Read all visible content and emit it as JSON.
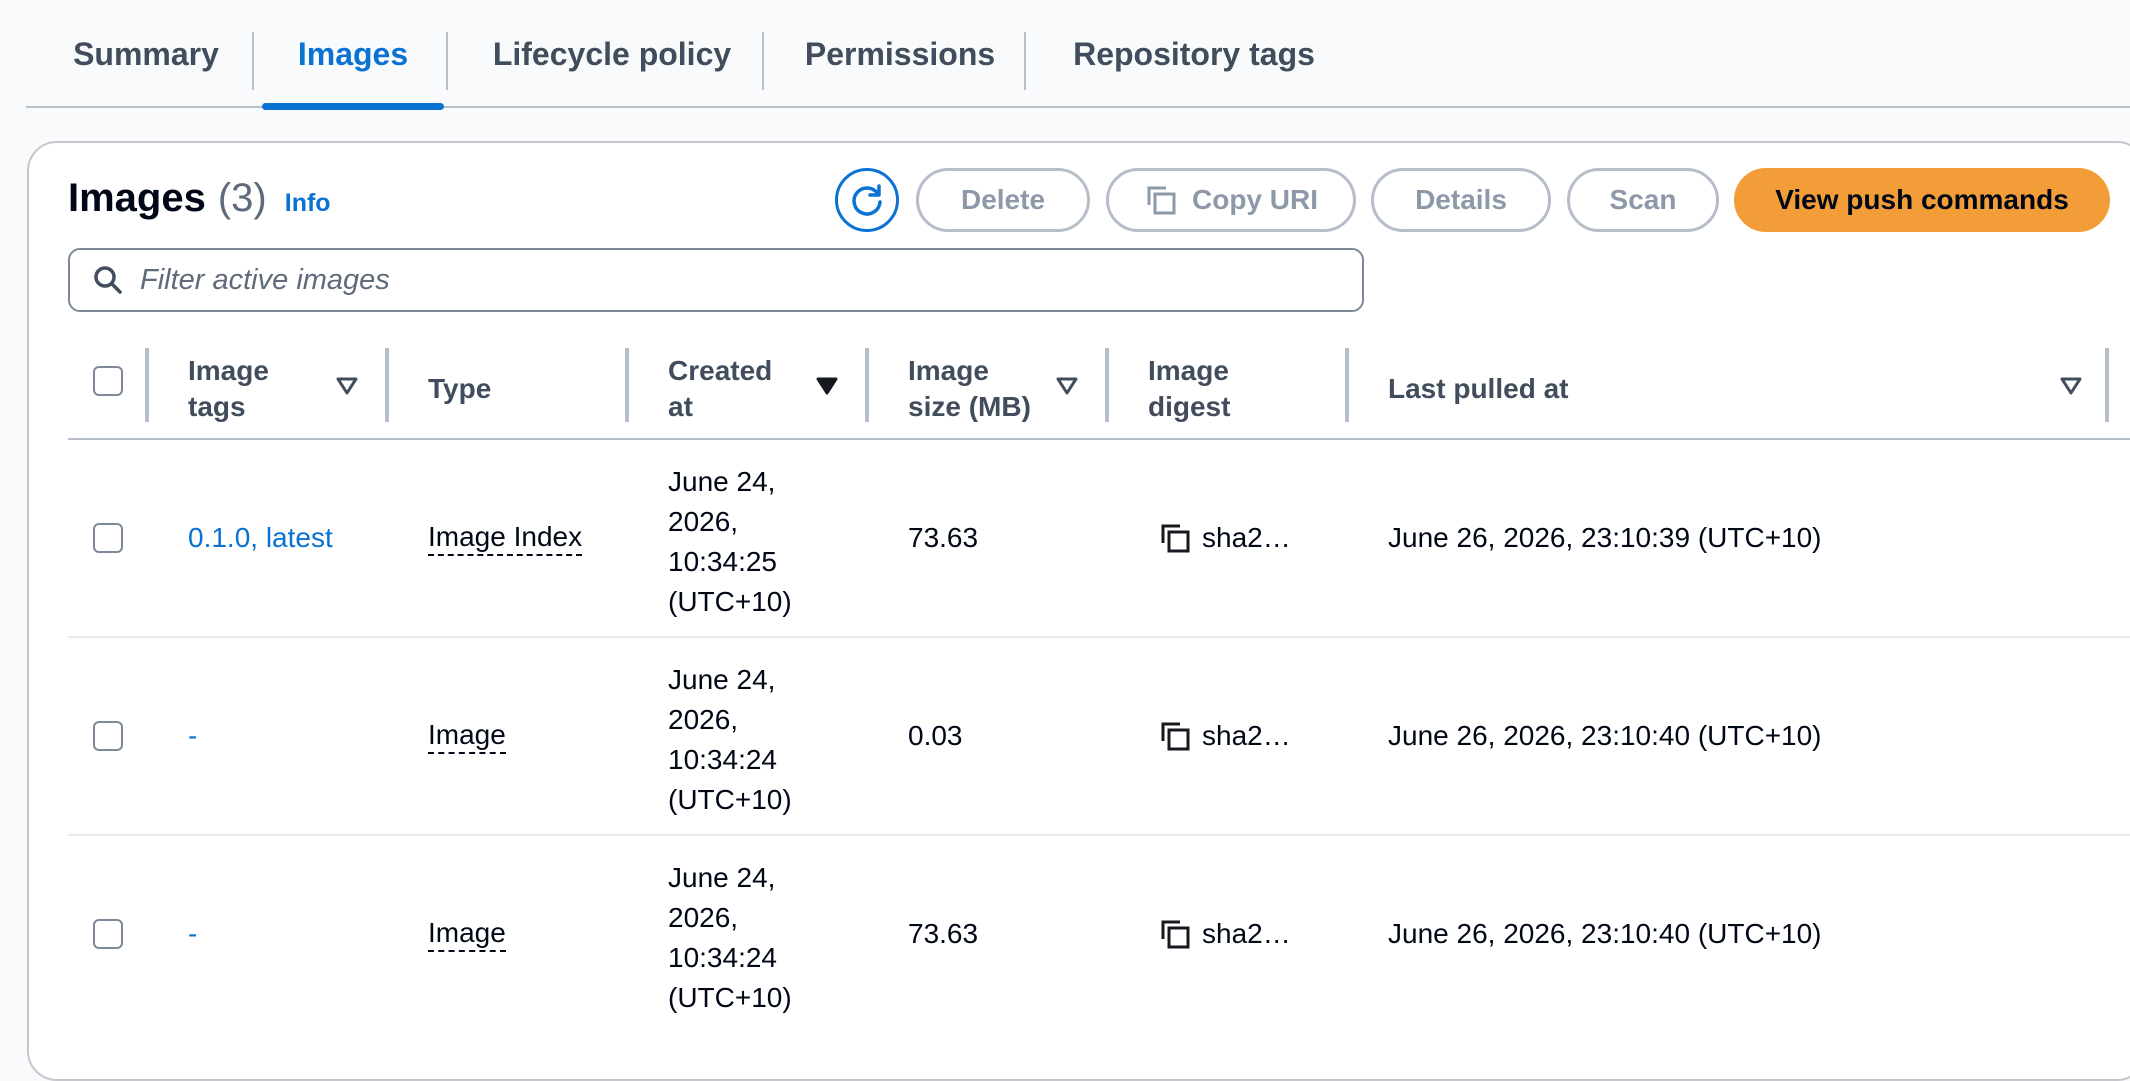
{
  "tabs": [
    {
      "label": "Summary"
    },
    {
      "label": "Images"
    },
    {
      "label": "Lifecycle policy"
    },
    {
      "label": "Permissions"
    },
    {
      "label": "Repository tags"
    }
  ],
  "header": {
    "title": "Images",
    "count": "(3)",
    "info_label": "Info"
  },
  "actions": {
    "delete_label": "Delete",
    "copy_uri_label": "Copy URI",
    "details_label": "Details",
    "scan_label": "Scan",
    "push_commands_label": "View push commands"
  },
  "search": {
    "placeholder": "Filter active images",
    "value": ""
  },
  "table": {
    "columns": [
      {
        "label": "Image tags"
      },
      {
        "label": "Type"
      },
      {
        "label": "Created at"
      },
      {
        "label": "Image size (MB)"
      },
      {
        "label": "Image digest"
      },
      {
        "label": "Last pulled at"
      }
    ],
    "rows": [
      {
        "tags": "0.1.0, latest",
        "type": "Image Index",
        "created_line1": "June 24,",
        "created_line2": "2026,",
        "created_line3": "10:34:25",
        "created_line4": "(UTC+10)",
        "size": "73.63",
        "digest": "sha2…",
        "last_pulled": "June 26, 2026, 23:10:39 (UTC+10)"
      },
      {
        "tags": "-",
        "type": "Image",
        "created_line1": "June 24,",
        "created_line2": "2026,",
        "created_line3": "10:34:24",
        "created_line4": "(UTC+10)",
        "size": "0.03",
        "digest": "sha2…",
        "last_pulled": "June 26, 2026, 23:10:40 (UTC+10)"
      },
      {
        "tags": "-",
        "type": "Image",
        "created_line1": "June 24,",
        "created_line2": "2026,",
        "created_line3": "10:34:24",
        "created_line4": "(UTC+10)",
        "size": "73.63",
        "digest": "sha2…",
        "last_pulled": "June 26, 2026, 23:10:40 (UTC+10)"
      }
    ]
  },
  "colors": {
    "accent": "#0972d3",
    "primary_button": "#f29d38",
    "disabled_text": "#8d99a8"
  }
}
